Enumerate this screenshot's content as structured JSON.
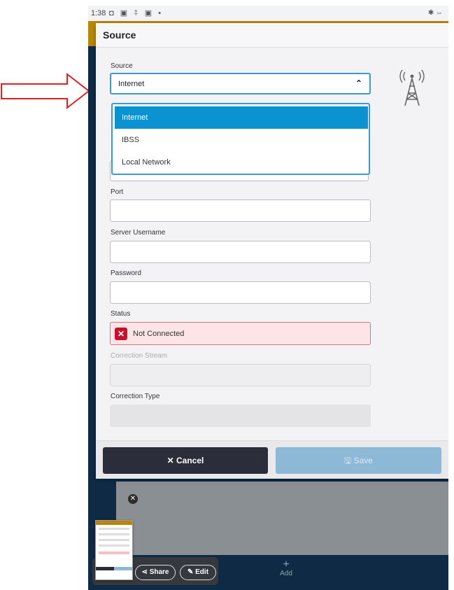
{
  "status_bar": {
    "time": "1:38",
    "icons": "◘ ▣ ⍏ ▣ •",
    "right_icons": "✱ ⇔"
  },
  "dialog": {
    "title": "Source",
    "source_label": "Source",
    "source_value": "Internet",
    "dropdown_options": [
      {
        "label": "Internet",
        "selected": true
      },
      {
        "label": "IBSS",
        "selected": false
      },
      {
        "label": "Local Network",
        "selected": false
      }
    ],
    "port_label": "Port",
    "port_value": "",
    "server_username_label": "Server Username",
    "server_username_value": "",
    "password_label": "Password",
    "password_value": "",
    "status_label": "Status",
    "status_value": "Not Connected",
    "correction_stream_label": "Correction Stream",
    "correction_type_label": "Correction Type",
    "cancel_label": "Cancel",
    "save_label": "Save"
  },
  "background": {
    "add_label": "Add"
  },
  "screenshot_overlay": {
    "share_label": "Share",
    "edit_label": "Edit"
  },
  "colors": {
    "accent_blue": "#0a93d0",
    "error_red": "#c8102e",
    "cancel_dark": "#2b2d3a",
    "save_disabled": "#8db8d6",
    "arrow_red": "#e02020"
  }
}
